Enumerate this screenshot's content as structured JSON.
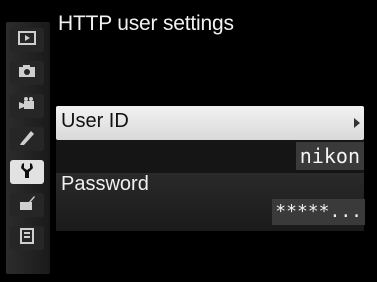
{
  "header": {
    "title": "HTTP user settings"
  },
  "sidebar": {
    "tabs": [
      {
        "icon": "playback-icon",
        "active": false
      },
      {
        "icon": "camera-icon",
        "active": false
      },
      {
        "icon": "movie-camera-icon",
        "active": false
      },
      {
        "icon": "pencil-icon",
        "active": false
      },
      {
        "icon": "wrench-icon",
        "active": true
      },
      {
        "icon": "retouch-icon",
        "active": false
      },
      {
        "icon": "my-menu-icon",
        "active": false
      }
    ]
  },
  "settings": {
    "user_id": {
      "label": "User ID",
      "value": "nikon"
    },
    "password": {
      "label": "Password",
      "value": "*****..."
    }
  }
}
